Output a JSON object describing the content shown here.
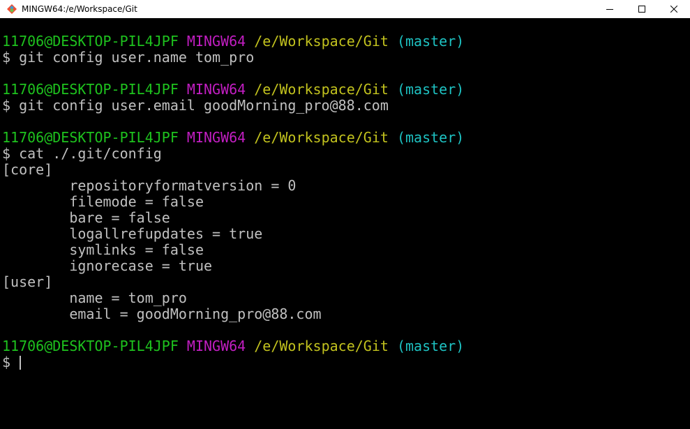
{
  "window": {
    "title": "MINGW64:/e/Workspace/Git"
  },
  "colors": {
    "green": "#1ec21e",
    "magenta": "#c21ec2",
    "yellow": "#c2c21e",
    "cyan": "#1ec2c2",
    "text": "#c0c0c0"
  },
  "prompt": {
    "user_host": "11706@DESKTOP-PIL4JPF",
    "system": "MINGW64",
    "cwd": "/e/Workspace/Git",
    "branch": "(master)"
  },
  "commands": {
    "cmd1": "$ git config user.name tom_pro",
    "cmd2": "$ git config user.email goodMorning_pro@88.com",
    "cmd3": "$ cat ./.git/config",
    "final_prompt": "$ "
  },
  "output": {
    "core_header": "[core]",
    "core_lines": [
      "        repositoryformatversion = 0",
      "        filemode = false",
      "        bare = false",
      "        logallrefupdates = true",
      "        symlinks = false",
      "        ignorecase = true"
    ],
    "user_header": "[user]",
    "user_lines": [
      "        name = tom_pro",
      "        email = goodMorning_pro@88.com"
    ]
  }
}
